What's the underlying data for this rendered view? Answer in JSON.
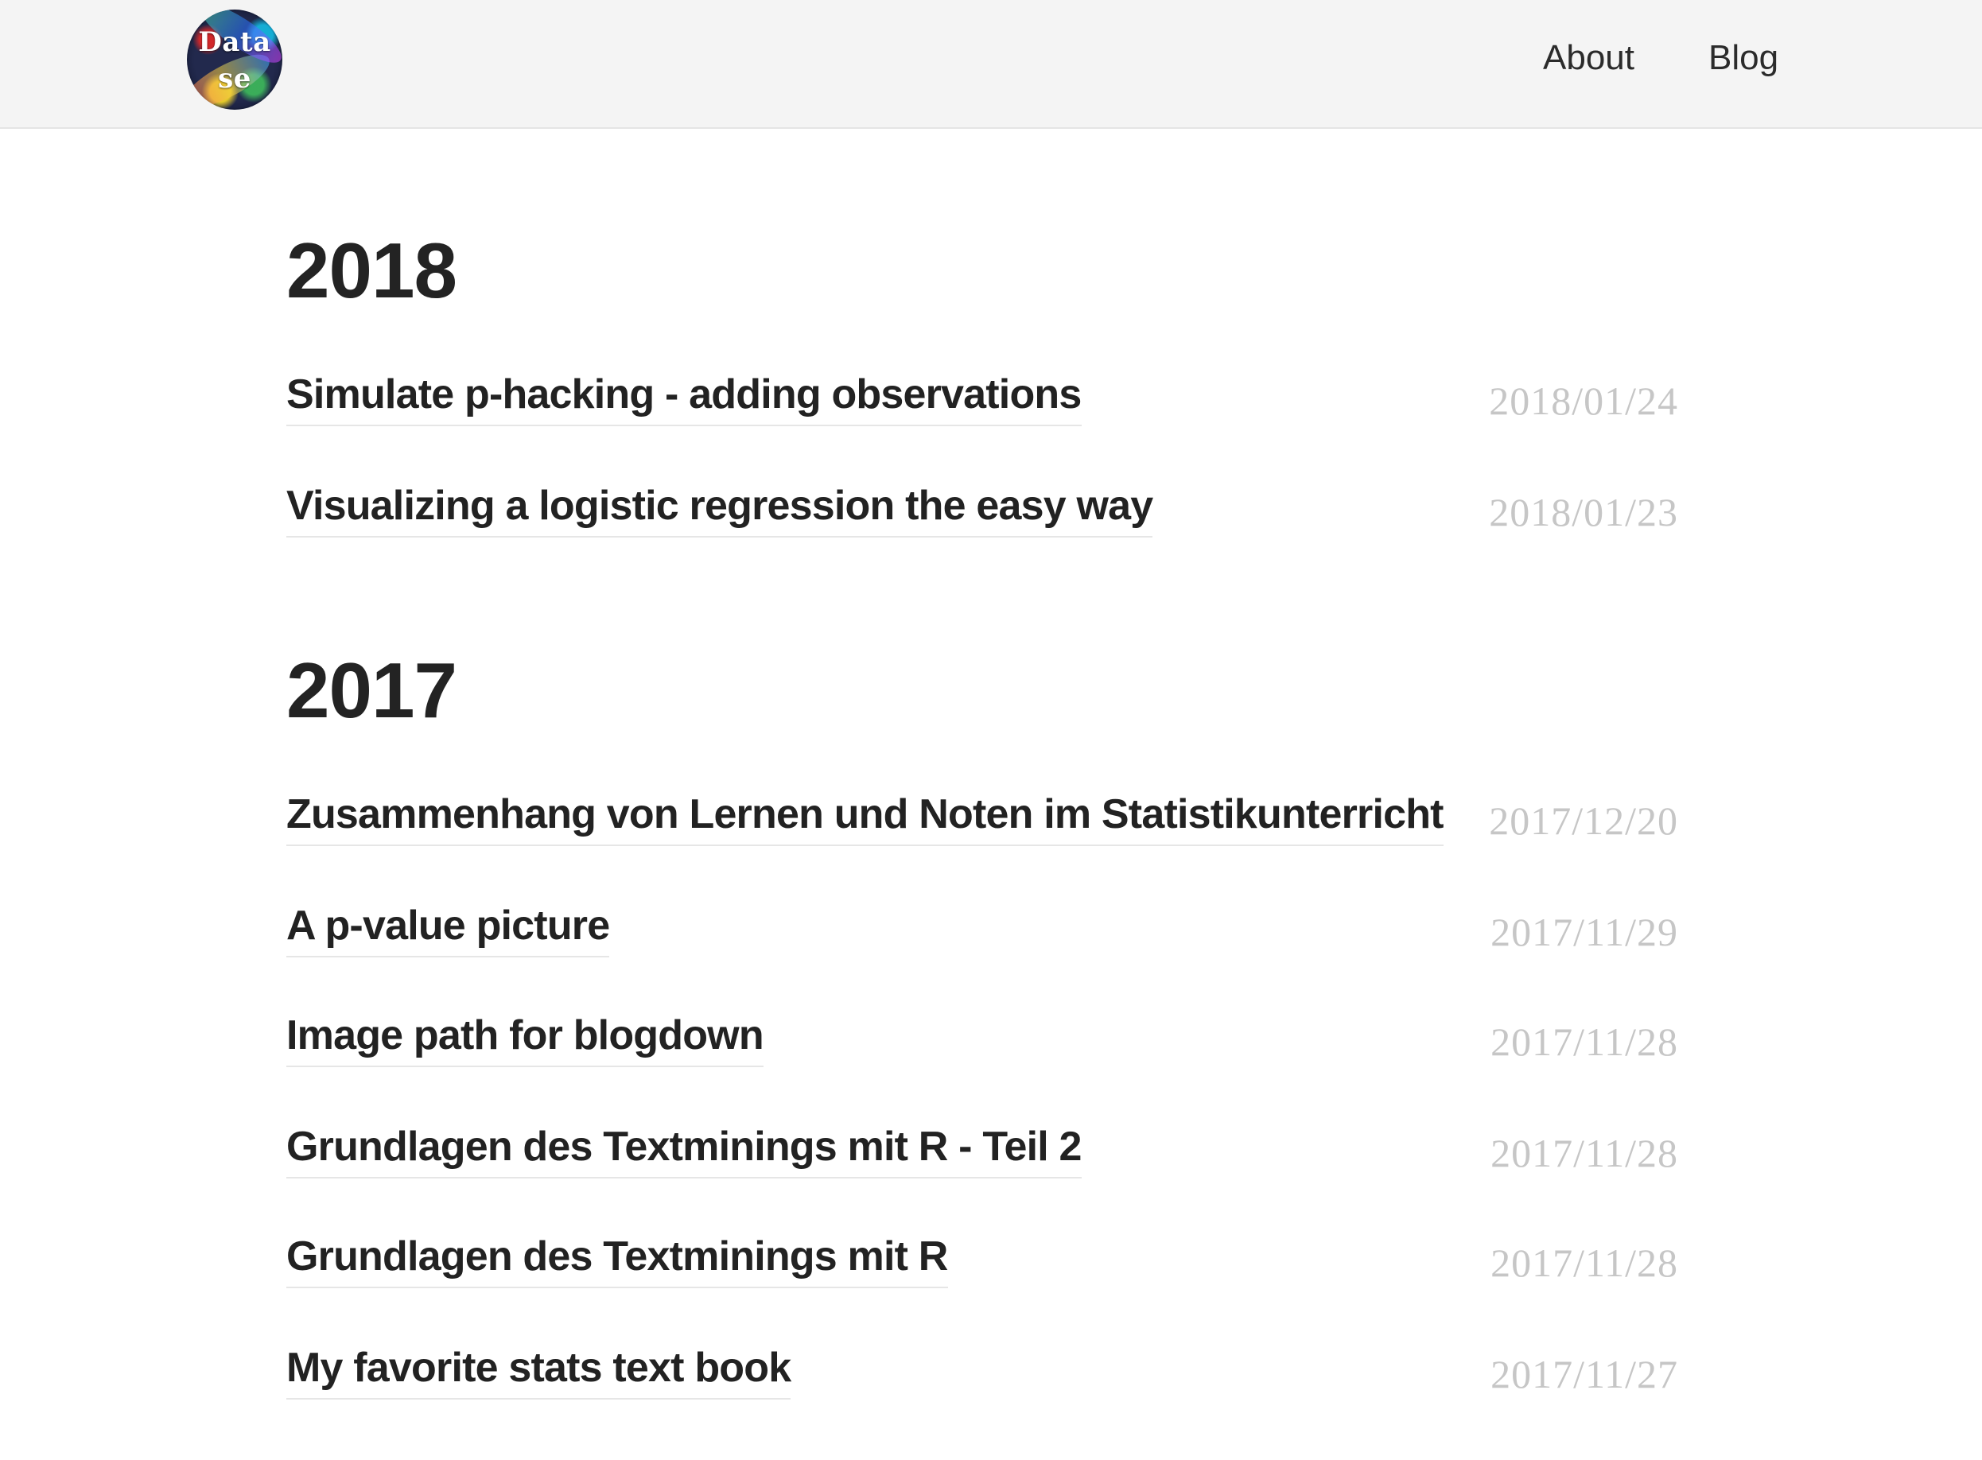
{
  "header": {
    "logo_text_line1": "Data",
    "logo_text_line2": "se",
    "nav": {
      "about": "About",
      "blog": "Blog"
    }
  },
  "archive": [
    {
      "year": "2018",
      "posts": [
        {
          "title": "Simulate p-hacking - adding observations",
          "date": "2018/01/24"
        },
        {
          "title": "Visualizing a logistic regression the easy way",
          "date": "2018/01/23"
        }
      ]
    },
    {
      "year": "2017",
      "posts": [
        {
          "title": "Zusammenhang von Lernen und Noten im Statistikunterricht",
          "date": "2017/12/20"
        },
        {
          "title": "A p-value picture",
          "date": "2017/11/29"
        },
        {
          "title": "Image path for blogdown",
          "date": "2017/11/28"
        },
        {
          "title": "Grundlagen des Textminings mit R - Teil 2",
          "date": "2017/11/28"
        },
        {
          "title": "Grundlagen des Textminings mit R",
          "date": "2017/11/28"
        },
        {
          "title": "My favorite stats text book",
          "date": "2017/11/27"
        }
      ]
    }
  ]
}
